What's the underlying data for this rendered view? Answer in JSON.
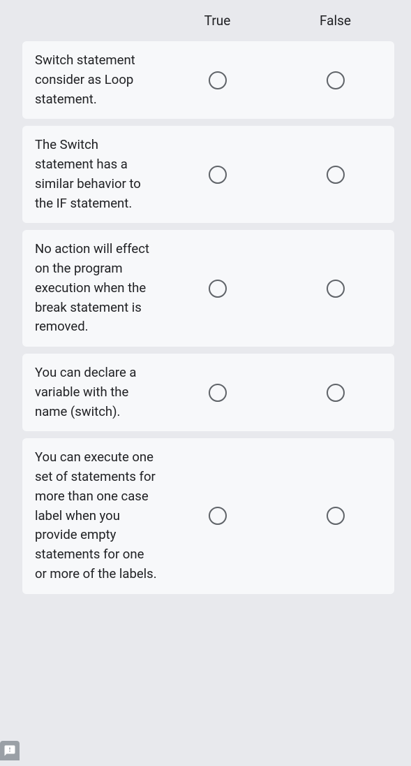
{
  "headers": {
    "col1": "True",
    "col2": "False"
  },
  "questions": [
    {
      "text": "Switch statement consider as Loop statement."
    },
    {
      "text": "The Switch statement has a similar behavior to the IF statement."
    },
    {
      "text": "No action will effect on the program execution when the break statement is removed."
    },
    {
      "text": "You can declare a variable with the name (switch)."
    },
    {
      "text": "You can execute one set of statements for more than one case label when you provide empty statements for one or more of the labels."
    }
  ]
}
